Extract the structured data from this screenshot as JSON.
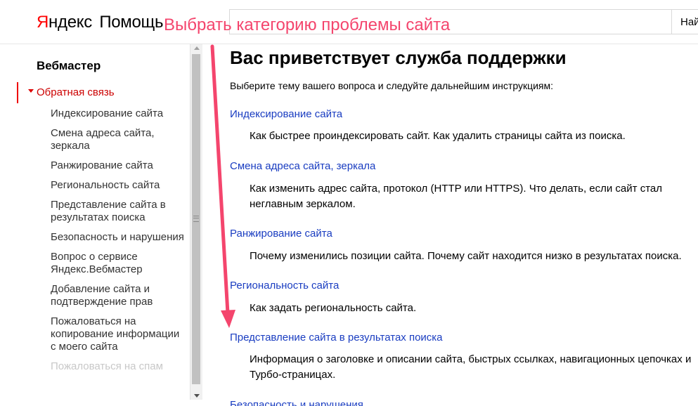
{
  "header": {
    "logo_brand_first": "Я",
    "logo_brand_rest": "ндекс",
    "logo_product": "Помощь",
    "search_value": "",
    "search_button": "Най"
  },
  "annotation": {
    "text": "Выбрать категорию проблемы сайта",
    "color": "#f4456d"
  },
  "sidebar": {
    "title": "Вебмастер",
    "section": "Обратная связь",
    "items": [
      "Индексирование сайта",
      "Смена адреса сайта, зеркала",
      "Ранжирование сайта",
      "Региональность сайта",
      "Представление сайта в результатах поиска",
      "Безопасность и нарушения",
      "Вопрос о сервисе Яндекс.Вебмастер",
      "Добавление сайта и подтверждение прав",
      "Пожаловаться на копирование информации с моего сайта",
      "Пожаловаться на спам"
    ]
  },
  "main": {
    "title": "Вас приветствует служба поддержки",
    "intro": "Выберите тему вашего вопроса и следуйте дальнейшим инструкциям:",
    "topics": [
      {
        "title": "Индексирование сайта",
        "desc": "Как быстрее проиндексировать сайт. Как удалить страницы сайта из поиска."
      },
      {
        "title": "Смена адреса сайта, зеркала",
        "desc": "Как изменить адрес сайта, протокол (HTTP или HTTPS). Что делать, если сайт стал неглавным зеркалом."
      },
      {
        "title": "Ранжирование сайта",
        "desc": "Почему изменились позиции сайта. Почему сайт находится низко в результатах поиска."
      },
      {
        "title": "Региональность сайта",
        "desc": "Как задать региональность сайта."
      },
      {
        "title": "Представление сайта в результатах поиска",
        "desc": "Информация о заголовке и описании сайта, быстрых ссылках, навигационных цепочках и Турбо-страницах."
      },
      {
        "title": "Безопасность и нарушения",
        "desc": ""
      }
    ]
  },
  "colors": {
    "link": "#1a3dc1",
    "accent_red": "#e00000",
    "annotation_pink": "#f4456d"
  }
}
